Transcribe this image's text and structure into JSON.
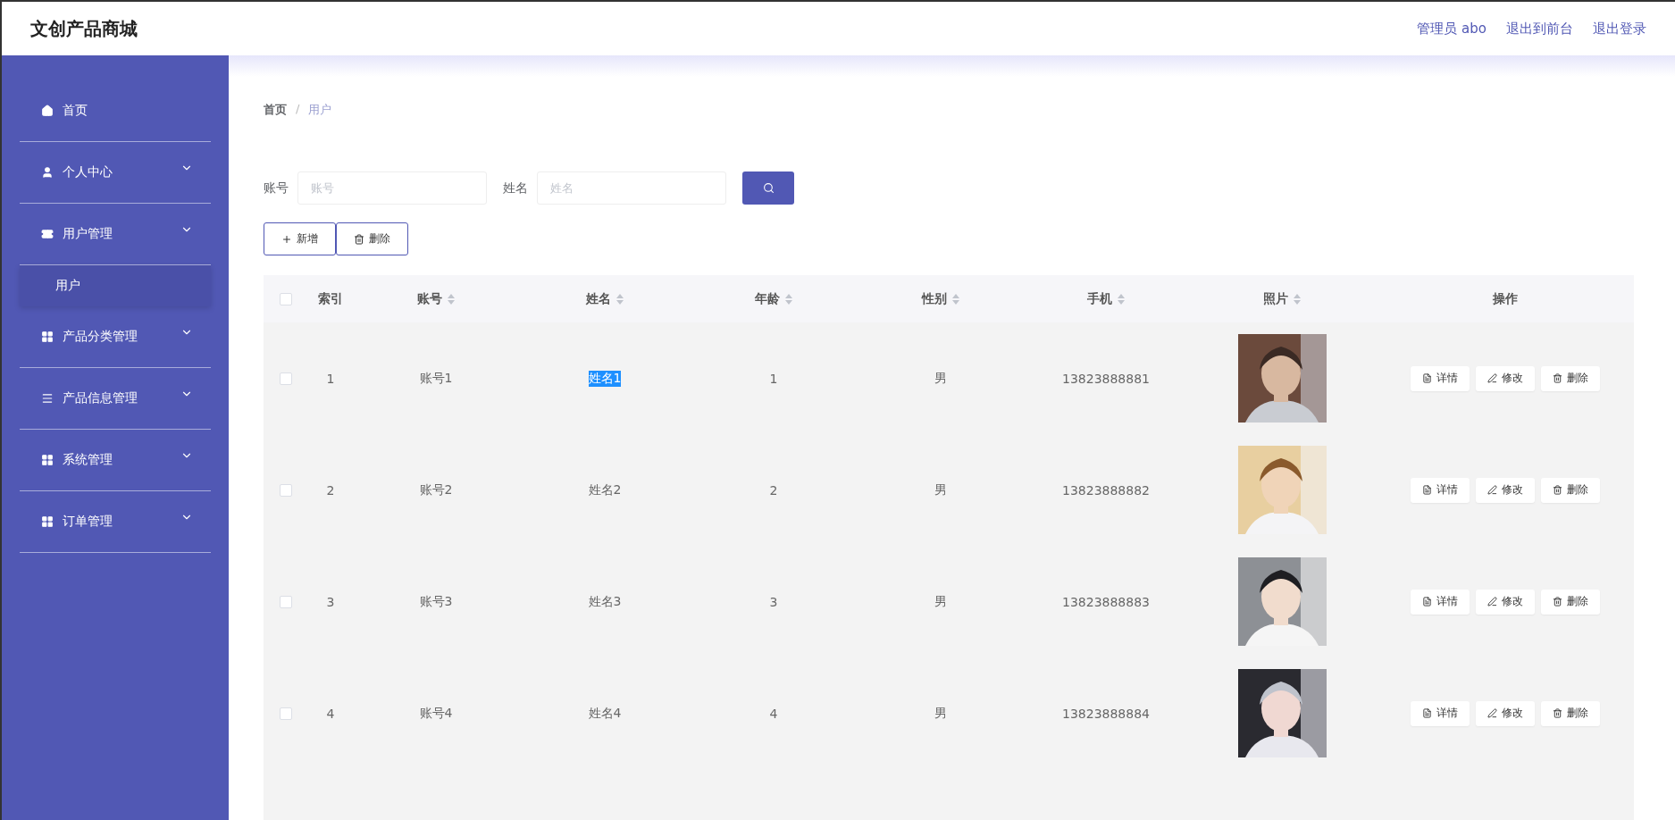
{
  "header": {
    "title": "文创产品商城",
    "links": [
      "管理员 abo",
      "退出到前台",
      "退出登录"
    ]
  },
  "sidebar": {
    "items": [
      {
        "label": "首页",
        "expandable": false
      },
      {
        "label": "个人中心",
        "expandable": true
      },
      {
        "label": "用户管理",
        "expandable": true,
        "expanded": true,
        "children": [
          {
            "label": "用户",
            "selected": true
          }
        ]
      },
      {
        "label": "产品分类管理",
        "expandable": true
      },
      {
        "label": "产品信息管理",
        "expandable": true
      },
      {
        "label": "系统管理",
        "expandable": true
      },
      {
        "label": "订单管理",
        "expandable": true
      }
    ]
  },
  "breadcrumb": {
    "items": [
      "首页",
      "用户"
    ],
    "separator": "/"
  },
  "search": {
    "fields": [
      {
        "label": "账号",
        "placeholder": "账号"
      },
      {
        "label": "姓名",
        "placeholder": "姓名"
      }
    ]
  },
  "actions": [
    "新增",
    "删除"
  ],
  "table": {
    "select_all_checked": false,
    "columns": [
      {
        "label": "索引",
        "sortable": false
      },
      {
        "label": "账号",
        "sortable": true
      },
      {
        "label": "姓名",
        "sortable": true
      },
      {
        "label": "年龄",
        "sortable": true
      },
      {
        "label": "性别",
        "sortable": true
      },
      {
        "label": "手机",
        "sortable": true
      },
      {
        "label": "照片",
        "sortable": true
      },
      {
        "label": "操作",
        "sortable": false
      }
    ],
    "rows": [
      {
        "checked": false,
        "index": "1",
        "account": "账号1",
        "name": "姓名1",
        "name_highlighted": true,
        "age": "1",
        "gender": "男",
        "phone": "13823888881",
        "photo": {
          "kind": "picture"
        },
        "buttons": [
          "详情",
          "修改",
          "删除"
        ]
      },
      {
        "checked": false,
        "index": "2",
        "account": "账号2",
        "name": "姓名2",
        "name_highlighted": false,
        "age": "2",
        "gender": "男",
        "phone": "13823888882",
        "photo": {
          "kind": "picture"
        },
        "buttons": [
          "详情",
          "修改",
          "删除"
        ]
      },
      {
        "checked": false,
        "index": "3",
        "account": "账号3",
        "name": "姓名3",
        "name_highlighted": false,
        "age": "3",
        "gender": "男",
        "phone": "13823888883",
        "photo": {
          "kind": "picture"
        },
        "buttons": [
          "详情",
          "修改",
          "删除"
        ]
      },
      {
        "checked": false,
        "index": "4",
        "account": "账号4",
        "name": "姓名4",
        "name_highlighted": false,
        "age": "4",
        "gender": "男",
        "phone": "13823888884",
        "photo": {
          "kind": "picture"
        },
        "buttons": [
          "详情",
          "修改",
          "删除"
        ]
      }
    ]
  }
}
